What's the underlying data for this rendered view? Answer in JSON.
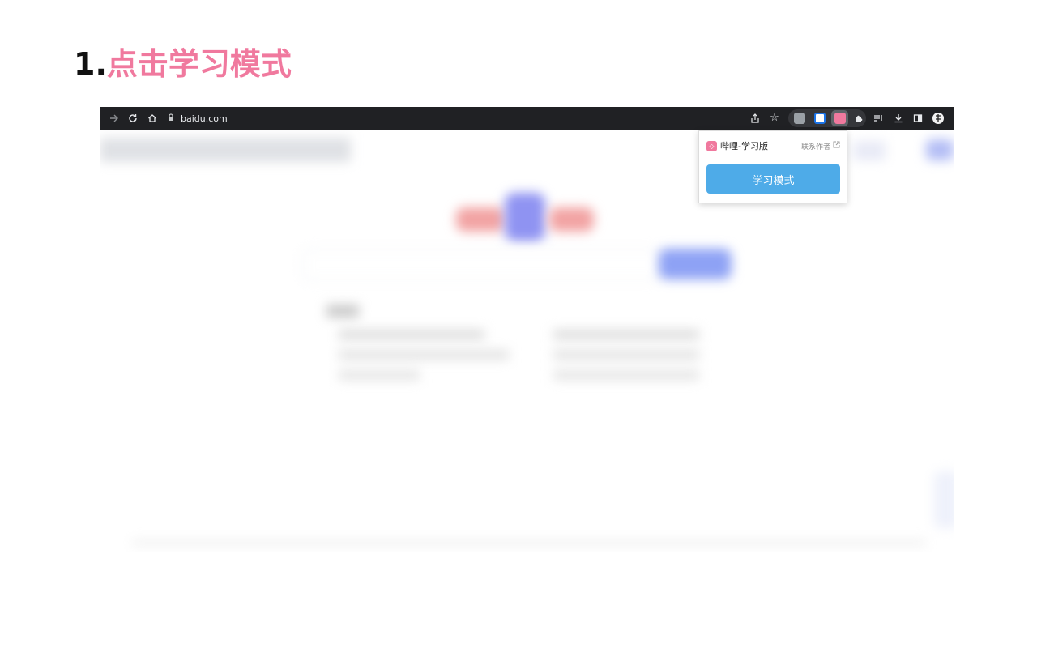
{
  "step": {
    "number": "1.",
    "text": "点击学习模式"
  },
  "browser": {
    "url": "baidu.com"
  },
  "icons": {
    "forward": "forward-arrow-icon",
    "reload": "reload-icon",
    "home": "home-icon",
    "lock": "lock-icon",
    "share": "share-icon",
    "bookmark": "star-icon",
    "extensions": "puzzle-icon",
    "reading_list": "reading-list-icon",
    "download": "download-icon",
    "side_panel": "side-panel-icon",
    "profile": "profile-avatar-icon"
  },
  "popup": {
    "title": "哔哩-学习版",
    "contact": "联系作者",
    "button": "学习模式"
  },
  "colors": {
    "accent": "#f0799e",
    "button": "#4eabe8",
    "toolbar": "#202124"
  }
}
